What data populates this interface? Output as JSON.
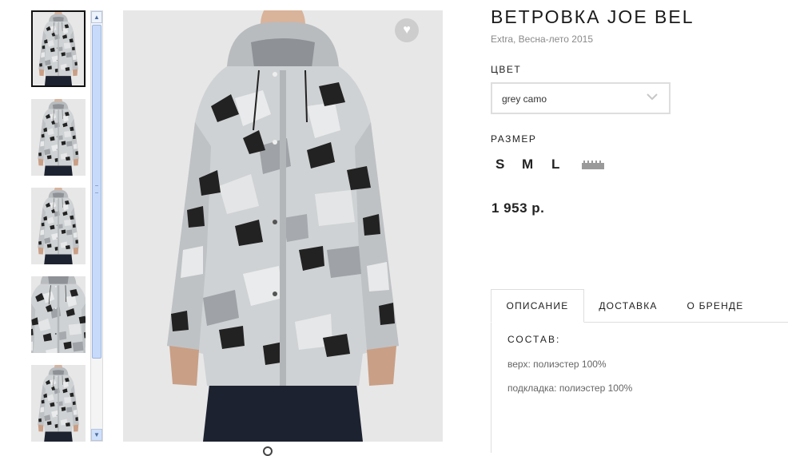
{
  "product": {
    "title": "ВЕТРОВКА JOE BEL",
    "subtitle": "Extra, Весна-лето 2015",
    "color_label": "ЦВЕТ",
    "color_value": "grey camo",
    "size_label": "РАЗМЕР",
    "sizes": [
      "S",
      "M",
      "L"
    ],
    "price": "1 953 р."
  },
  "tabs": [
    "ОПИСАНИЕ",
    "ДОСТАВКА",
    "О БРЕНДЕ"
  ],
  "active_tab": "ОПИСАНИЕ",
  "description": {
    "heading": "СОСТАВ:",
    "lines": [
      "верх: полиэстер 100%",
      "подкладка: полиэстер 100%"
    ]
  },
  "gallery": {
    "thumbnail_count": 5,
    "selected_index": 0
  },
  "icons": {
    "favorite": "heart-icon",
    "dropdown": "chevron-down-icon",
    "size_chart": "ruler-icon",
    "scroll_up": "arrow-up-icon",
    "scroll_down": "arrow-down-icon"
  },
  "colors": {
    "text": "#222222",
    "muted": "#8a8a8a",
    "border": "#dedede",
    "scrollbar": "#c7dafa"
  }
}
